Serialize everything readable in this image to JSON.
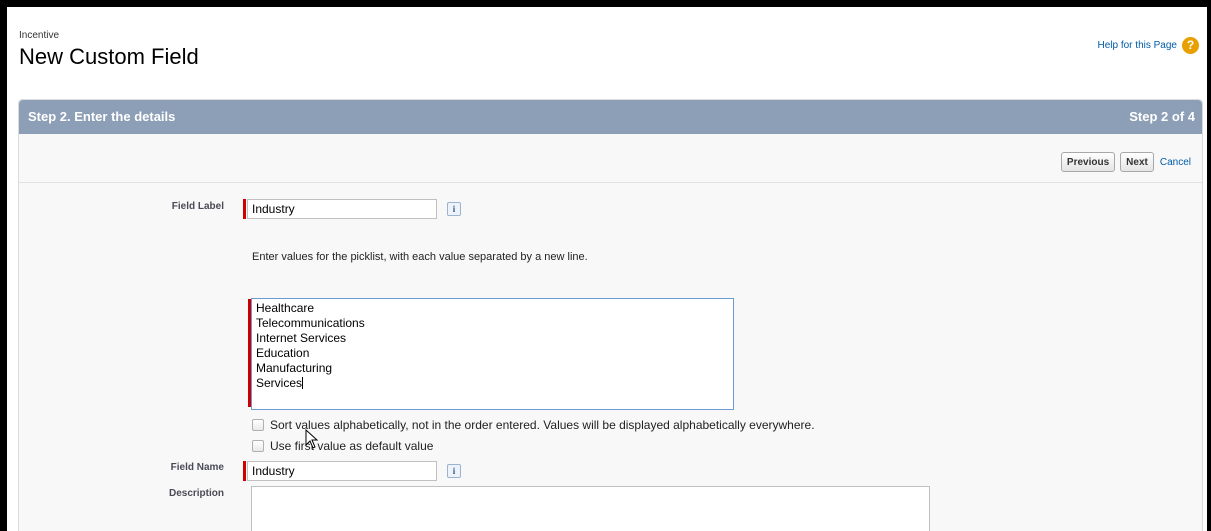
{
  "header": {
    "breadcrumb": "Incentive",
    "title": "New Custom Field",
    "help_link": "Help for this Page",
    "help_icon": "?"
  },
  "step": {
    "title": "Step 2. Enter the details",
    "count": "Step 2 of 4"
  },
  "buttons": {
    "previous": "Previous",
    "next": "Next",
    "cancel": "Cancel"
  },
  "form": {
    "field_label": {
      "label": "Field Label",
      "value": "Industry"
    },
    "picklist_hint": "Enter values for the picklist, with each value separated by a new line.",
    "picklist_values": [
      "Healthcare",
      "Telecommunications",
      "Internet Services",
      "Education",
      "Manufacturing",
      "Services"
    ],
    "sort_option": "Sort values alphabetically, not in the order entered. Values will be displayed alphabetically everywhere.",
    "default_option": "Use first value as default value",
    "field_name": {
      "label": "Field Name",
      "value": "Industry"
    },
    "description": {
      "label": "Description",
      "value": ""
    },
    "info_icon": "i"
  },
  "colors": {
    "step_bar": "#8c9fb7",
    "required": "#cc0000",
    "link": "#015ba7",
    "help_icon": "#e8a000"
  }
}
